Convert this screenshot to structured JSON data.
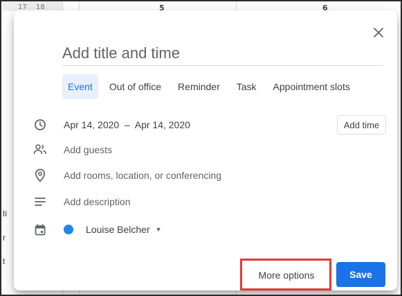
{
  "calendar_bg": {
    "day_numbers": [
      "17",
      "18",
      "5",
      "6"
    ],
    "left_fragments": [
      "ti",
      "r",
      "t"
    ]
  },
  "dialog": {
    "title_placeholder": "Add title and time",
    "tabs": [
      {
        "label": "Event",
        "active": true
      },
      {
        "label": "Out of office",
        "active": false
      },
      {
        "label": "Reminder",
        "active": false
      },
      {
        "label": "Task",
        "active": false
      },
      {
        "label": "Appointment slots",
        "active": false
      }
    ],
    "date_range": "Apr 14, 2020  –  Apr 14, 2020",
    "add_time_label": "Add time",
    "guests_placeholder": "Add guests",
    "location_placeholder": "Add rooms, location, or conferencing",
    "description_placeholder": "Add description",
    "calendar_owner": "Louise Belcher",
    "more_options_label": "More options",
    "save_label": "Save"
  },
  "colors": {
    "accent": "#1a73e8",
    "calendar_dot": "#1e88e5",
    "highlight": "#e53935"
  }
}
